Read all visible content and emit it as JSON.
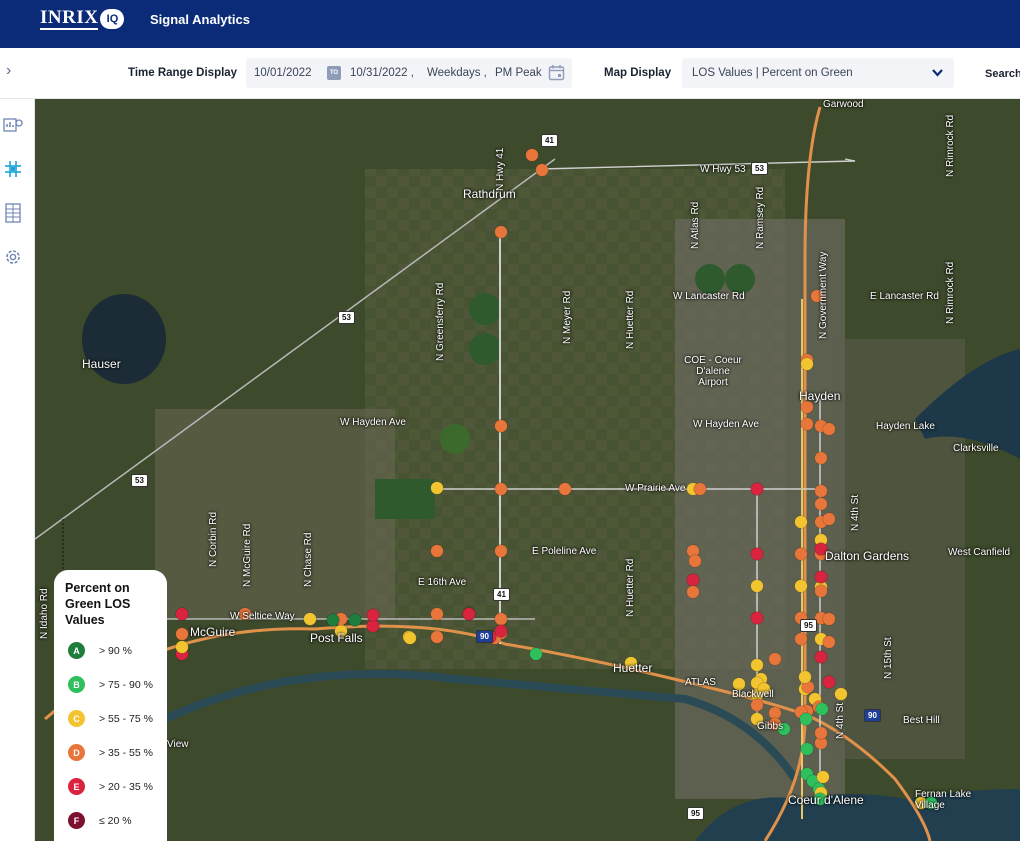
{
  "header": {
    "logo_text": "INRIX",
    "logo_badge": "IQ",
    "app_title": "Signal Analytics"
  },
  "toolbar": {
    "time_range_label": "Time Range Display",
    "start_date": "10/01/2022",
    "to_badge": "TO",
    "end_date": "10/31/2022 ,",
    "days": "Weekdays ,",
    "period": "PM Peak",
    "map_display_label": "Map Display",
    "map_display_value": "LOS Values | Percent on Green",
    "search_label": "Search"
  },
  "icons": {
    "expand": "chevron-right-icon",
    "nav": [
      "dashboard-icon",
      "signal-network-icon",
      "corridor-icon",
      "settings-icon"
    ],
    "calendar": "calendar-icon",
    "dropdown": "chevron-down-icon"
  },
  "map": {
    "places": [
      "Rathdrum",
      "Hauser",
      "Hayden",
      "Hayden Lake",
      "Clarksville",
      "Dalton Gardens",
      "West Canfield",
      "Post Falls",
      "McGuire",
      "Huetter",
      "Blackwell",
      "Gibbs",
      "Coeur d'Alene",
      "Fernan Lake Village",
      "Garwood",
      "Best Hill",
      "View"
    ],
    "airport": "COE - Coeur D'alene Airport",
    "roads": [
      "W Hwy 53",
      "W Lancaster Rd",
      "E Lancaster Rd",
      "W Hayden Ave",
      "W Prairie Ave",
      "E Poleline Ave",
      "E 16th Ave",
      "W Seltice Way",
      "ATLAS",
      "N Hwy 41",
      "N Greensferry Rd",
      "N Meyer Rd",
      "N Huetter Rd",
      "N Atlas Rd",
      "N Ramsey Rd",
      "N Government Way",
      "N Rimrock Rd",
      "N 4th St",
      "N 15th St",
      "N Corbin Rd",
      "N McGuire Rd",
      "N Chase Rd",
      "N Idaho Rd"
    ],
    "shields": [
      "41",
      "53",
      "53",
      "53",
      "41",
      "90",
      "95",
      "90",
      "95"
    ]
  },
  "legend": {
    "title": "Percent on Green LOS Values",
    "items": [
      {
        "grade": "A",
        "range": "> 90 %",
        "color": "#1e7d3d"
      },
      {
        "grade": "B",
        "range": "> 75 - 90 %",
        "color": "#2fbf5c"
      },
      {
        "grade": "C",
        "range": "> 55 - 75 %",
        "color": "#f2c530"
      },
      {
        "grade": "D",
        "range": "> 35 - 55 %",
        "color": "#e8763a"
      },
      {
        "grade": "E",
        "range": "> 20 - 35 %",
        "color": "#d9243f"
      },
      {
        "grade": "F",
        "range": "≤ 20 %",
        "color": "#7c1230"
      }
    ]
  },
  "signals": [
    {
      "los": "D"
    },
    {
      "los": "D"
    },
    {
      "los": "D"
    },
    {
      "los": "D"
    },
    {
      "los": "D"
    },
    {
      "los": "C"
    },
    {
      "los": "D"
    },
    {
      "los": "C"
    },
    {
      "los": "D"
    },
    {
      "los": "D"
    },
    {
      "los": "D"
    },
    {
      "los": "D"
    },
    {
      "los": "E"
    },
    {
      "los": "D"
    },
    {
      "los": "D"
    },
    {
      "los": "D"
    },
    {
      "los": "C"
    },
    {
      "los": "D"
    },
    {
      "los": "D"
    },
    {
      "los": "D"
    },
    {
      "los": "C"
    },
    {
      "los": "D"
    },
    {
      "los": "E"
    },
    {
      "los": "D"
    },
    {
      "los": "D"
    },
    {
      "los": "C"
    },
    {
      "los": "C"
    },
    {
      "los": "C"
    },
    {
      "los": "C"
    },
    {
      "los": "E"
    },
    {
      "los": "D"
    },
    {
      "los": "D"
    },
    {
      "los": "C"
    },
    {
      "los": "D"
    },
    {
      "los": "C"
    },
    {
      "los": "E"
    },
    {
      "los": "D"
    },
    {
      "los": "C"
    },
    {
      "los": "D"
    },
    {
      "los": "E"
    },
    {
      "los": "D"
    },
    {
      "los": "D"
    },
    {
      "los": "E"
    },
    {
      "los": "D"
    },
    {
      "los": "E"
    },
    {
      "los": "C"
    },
    {
      "los": "C"
    },
    {
      "los": "C"
    },
    {
      "los": "D"
    },
    {
      "los": "E"
    },
    {
      "los": "E"
    },
    {
      "los": "D"
    },
    {
      "los": "D"
    },
    {
      "los": "C"
    },
    {
      "los": "B"
    },
    {
      "los": "D"
    },
    {
      "los": "C"
    },
    {
      "los": "D"
    },
    {
      "los": "D"
    },
    {
      "los": "E"
    },
    {
      "los": "D"
    },
    {
      "los": "A"
    },
    {
      "los": "A"
    },
    {
      "los": "C"
    },
    {
      "los": "E"
    },
    {
      "los": "E"
    },
    {
      "los": "E"
    },
    {
      "los": "D"
    },
    {
      "los": "D"
    },
    {
      "los": "D"
    },
    {
      "los": "C"
    },
    {
      "los": "C"
    },
    {
      "los": "D"
    },
    {
      "los": "C"
    },
    {
      "los": "C"
    },
    {
      "los": "C"
    },
    {
      "los": "C"
    },
    {
      "los": "C"
    },
    {
      "los": "D"
    },
    {
      "los": "D"
    },
    {
      "los": "C"
    },
    {
      "los": "D"
    },
    {
      "los": "D"
    },
    {
      "los": "B"
    },
    {
      "los": "D"
    },
    {
      "los": "B"
    },
    {
      "los": "B"
    },
    {
      "los": "B"
    },
    {
      "los": "C"
    },
    {
      "los": "B"
    },
    {
      "los": "C"
    },
    {
      "los": "B"
    },
    {
      "los": "B"
    },
    {
      "los": "E"
    },
    {
      "los": "D"
    },
    {
      "los": "D"
    },
    {
      "los": "D"
    },
    {
      "los": "D"
    },
    {
      "los": "D"
    },
    {
      "los": "E"
    },
    {
      "los": "E"
    },
    {
      "los": "D"
    },
    {
      "los": "C"
    },
    {
      "los": "B"
    },
    {
      "los": "C"
    },
    {
      "los": "B"
    }
  ]
}
